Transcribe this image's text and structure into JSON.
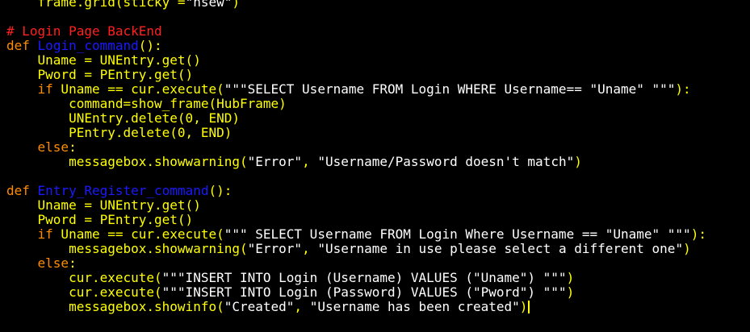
{
  "colors": {
    "background": "#000000",
    "plain": "#ffff00",
    "keyword": "#ff8c00",
    "function_name": "#1a1aff",
    "string": "#ffffff",
    "comment": "#ff2020",
    "cursor": "#ffff00"
  },
  "code": {
    "lines": [
      {
        "kind": "frame-grid-call",
        "tokens": [
          {
            "text": "    frame.grid(sticky =",
            "style": "plain"
          },
          {
            "text": "\"nsew\"",
            "style": "string"
          },
          {
            "text": ")",
            "style": "plain"
          }
        ]
      },
      {
        "kind": "blank-line",
        "tokens": []
      },
      {
        "kind": "comment-line",
        "tokens": [
          {
            "text": "# Login Page BackEnd",
            "style": "comment"
          }
        ]
      },
      {
        "kind": "function-def",
        "tokens": [
          {
            "text": "def",
            "style": "keyword"
          },
          {
            "text": " ",
            "style": "plain"
          },
          {
            "text": "Login_command",
            "style": "function_name"
          },
          {
            "text": "():",
            "style": "plain"
          }
        ]
      },
      {
        "kind": "assignment",
        "tokens": [
          {
            "text": "    Uname = UNEntry.get()",
            "style": "plain"
          }
        ]
      },
      {
        "kind": "assignment",
        "tokens": [
          {
            "text": "    Pword = PEntry.get()",
            "style": "plain"
          }
        ]
      },
      {
        "kind": "if-statement",
        "tokens": [
          {
            "text": "    ",
            "style": "plain"
          },
          {
            "text": "if",
            "style": "keyword"
          },
          {
            "text": " Uname == cur.execute(",
            "style": "plain"
          },
          {
            "text": "\"\"\"SELECT Username FROM Login WHERE Username== \"Uname\" \"\"\"",
            "style": "string"
          },
          {
            "text": "):",
            "style": "plain"
          }
        ]
      },
      {
        "kind": "statement",
        "tokens": [
          {
            "text": "        command=show_frame(HubFrame)",
            "style": "plain"
          }
        ]
      },
      {
        "kind": "statement",
        "tokens": [
          {
            "text": "        UNEntry.delete(0, END)",
            "style": "plain"
          }
        ]
      },
      {
        "kind": "statement",
        "tokens": [
          {
            "text": "        PEntry.delete(0, END)",
            "style": "plain"
          }
        ]
      },
      {
        "kind": "else-statement",
        "tokens": [
          {
            "text": "    ",
            "style": "plain"
          },
          {
            "text": "else",
            "style": "keyword"
          },
          {
            "text": ":",
            "style": "plain"
          }
        ]
      },
      {
        "kind": "statement",
        "tokens": [
          {
            "text": "        messagebox.showwarning(",
            "style": "plain"
          },
          {
            "text": "\"Error\"",
            "style": "string"
          },
          {
            "text": ", ",
            "style": "plain"
          },
          {
            "text": "\"Username/Password doesn't match\"",
            "style": "string"
          },
          {
            "text": ")",
            "style": "plain"
          }
        ]
      },
      {
        "kind": "blank-line",
        "tokens": []
      },
      {
        "kind": "function-def",
        "tokens": [
          {
            "text": "def",
            "style": "keyword"
          },
          {
            "text": " ",
            "style": "plain"
          },
          {
            "text": "Entry_Register_command",
            "style": "function_name"
          },
          {
            "text": "():",
            "style": "plain"
          }
        ]
      },
      {
        "kind": "assignment",
        "tokens": [
          {
            "text": "    Uname = UNEntry.get()",
            "style": "plain"
          }
        ]
      },
      {
        "kind": "assignment",
        "tokens": [
          {
            "text": "    Pword = PEntry.get()",
            "style": "plain"
          }
        ]
      },
      {
        "kind": "if-statement",
        "tokens": [
          {
            "text": "    ",
            "style": "plain"
          },
          {
            "text": "if",
            "style": "keyword"
          },
          {
            "text": " Uname == cur.execute(",
            "style": "plain"
          },
          {
            "text": "\"\"\" SELECT Username FROM Login Where Username == \"Uname\" \"\"\"",
            "style": "string"
          },
          {
            "text": "):",
            "style": "plain"
          }
        ]
      },
      {
        "kind": "statement",
        "tokens": [
          {
            "text": "        messagebox.showwarning(",
            "style": "plain"
          },
          {
            "text": "\"Error\"",
            "style": "string"
          },
          {
            "text": ", ",
            "style": "plain"
          },
          {
            "text": "\"Username in use please select a different one\"",
            "style": "string"
          },
          {
            "text": ")",
            "style": "plain"
          }
        ]
      },
      {
        "kind": "else-statement",
        "tokens": [
          {
            "text": "    ",
            "style": "plain"
          },
          {
            "text": "else",
            "style": "keyword"
          },
          {
            "text": ":",
            "style": "plain"
          }
        ]
      },
      {
        "kind": "statement",
        "tokens": [
          {
            "text": "        cur.execute(",
            "style": "plain"
          },
          {
            "text": "\"\"\"INSERT INTO Login (Username) VALUES (\"Uname\") \"\"\"",
            "style": "string"
          },
          {
            "text": ")",
            "style": "plain"
          }
        ]
      },
      {
        "kind": "statement",
        "tokens": [
          {
            "text": "        cur.execute(",
            "style": "plain"
          },
          {
            "text": "\"\"\"INSERT INTO Login (Password) VALUES (\"Pword\") \"\"\"",
            "style": "string"
          },
          {
            "text": ")",
            "style": "plain"
          }
        ]
      },
      {
        "kind": "statement",
        "cursor": true,
        "tokens": [
          {
            "text": "        messagebox.showinfo(",
            "style": "plain"
          },
          {
            "text": "\"Created\"",
            "style": "string"
          },
          {
            "text": ", ",
            "style": "plain"
          },
          {
            "text": "\"Username has been created\"",
            "style": "string"
          },
          {
            "text": ")",
            "style": "plain"
          }
        ]
      }
    ]
  }
}
